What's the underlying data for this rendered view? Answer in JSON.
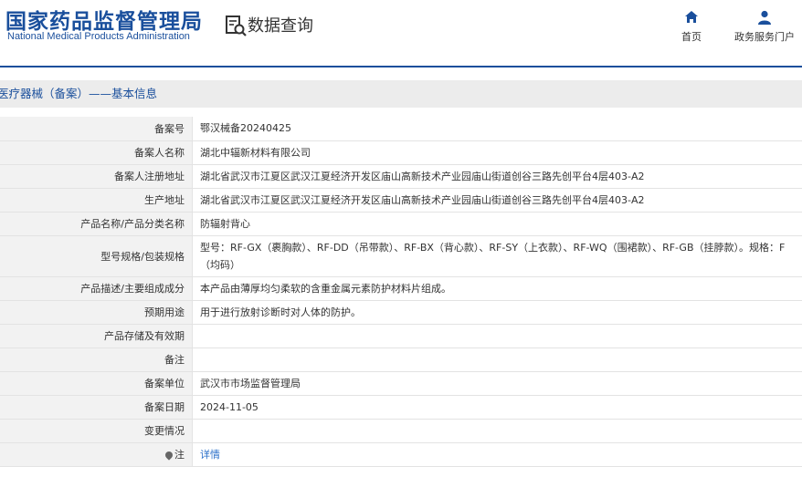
{
  "header": {
    "logo_cn": "国家药品监督管理局",
    "logo_en": "National Medical Products Administration",
    "page_title": "数据查询",
    "nav": [
      {
        "label": "首页",
        "icon": "home-icon"
      },
      {
        "label": "政务服务门户",
        "icon": "user-icon"
      }
    ],
    "brand_color": "#1a4f9c"
  },
  "section": {
    "title": "医疗器械（备案）——基本信息"
  },
  "detail": {
    "rows": [
      {
        "label": "备案号",
        "value": "鄂汉械备20240425"
      },
      {
        "label": "备案人名称",
        "value": "湖北中辐新材料有限公司"
      },
      {
        "label": "备案人注册地址",
        "value": "湖北省武汉市江夏区武汉江夏经济开发区庙山高新技术产业园庙山街道创谷三路先创平台4层403-A2"
      },
      {
        "label": "生产地址",
        "value": "湖北省武汉市江夏区武汉江夏经济开发区庙山高新技术产业园庙山街道创谷三路先创平台4层403-A2"
      },
      {
        "label": "产品名称/产品分类名称",
        "value": "防辐射背心"
      },
      {
        "label": "型号规格/包装规格",
        "value": "型号：RF-GX（裹胸款）、RF-DD（吊带款）、RF-BX（背心款）、RF-SY（上衣款）、RF-WQ（围裙款）、RF-GB（挂脖款）。规格：F（均码）"
      },
      {
        "label": "产品描述/主要组成成分",
        "value": "本产品由薄厚均匀柔软的含重金属元素防护材料片组成。"
      },
      {
        "label": "预期用途",
        "value": "用于进行放射诊断时对人体的防护。"
      },
      {
        "label": "产品存储及有效期",
        "value": ""
      },
      {
        "label": "备注",
        "value": ""
      },
      {
        "label": "备案单位",
        "value": "武汉市市场监督管理局"
      },
      {
        "label": "备案日期",
        "value": "2024-11-05"
      },
      {
        "label": "变更情况",
        "value": ""
      },
      {
        "label": "注",
        "value": "详情"
      }
    ]
  }
}
